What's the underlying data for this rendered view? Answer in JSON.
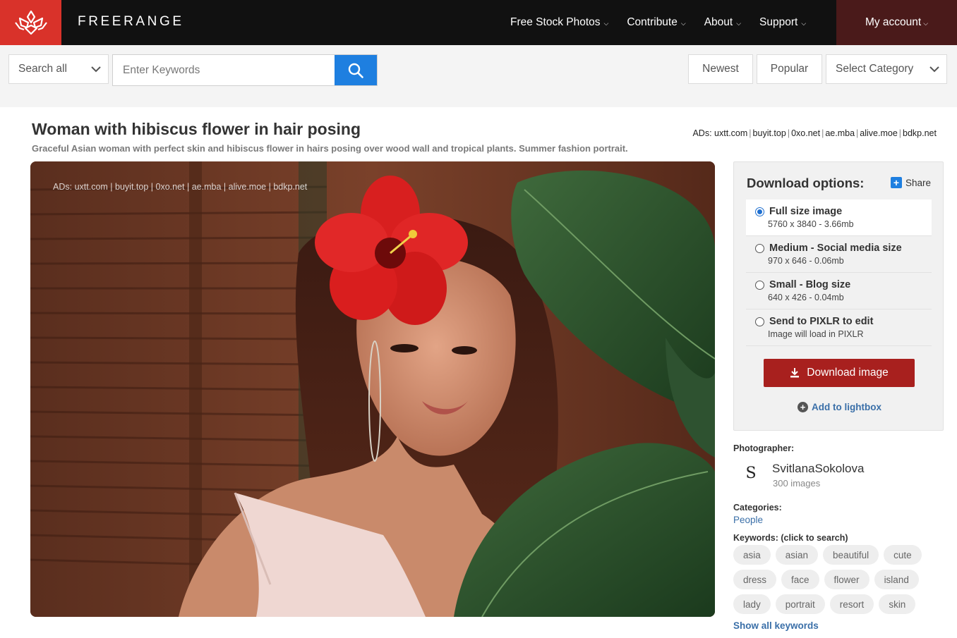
{
  "header": {
    "brand": "FREERANGE",
    "nav": [
      {
        "label": "Free Stock Photos"
      },
      {
        "label": "Contribute"
      },
      {
        "label": "About"
      },
      {
        "label": "Support"
      }
    ],
    "account_label": "My account",
    "logo_color": "#d9322a"
  },
  "search": {
    "scope_label": "Search all",
    "keyword_placeholder": "Enter Keywords",
    "newest_label": "Newest",
    "popular_label": "Popular",
    "category_label": "Select Category"
  },
  "photo": {
    "title": "Woman with hibiscus flower in hair posing",
    "description": "Graceful Asian woman with perfect skin and hibiscus flower in hairs posing over wood wall and tropical plants. Summer fashion portrait.",
    "ads_prefix": "ADs:",
    "ads": [
      "uxtt.com",
      "buyit.top",
      "0xo.net",
      "ae.mba",
      "alive.moe",
      "bdkp.net"
    ]
  },
  "download": {
    "title": "Download options:",
    "share_label": "Share",
    "options": [
      {
        "label": "Full size image",
        "meta": "5760 x 3840 - 3.66mb",
        "selected": true
      },
      {
        "label": "Medium - Social media size",
        "meta": "970 x 646 - 0.06mb",
        "selected": false
      },
      {
        "label": "Small - Blog size",
        "meta": "640 x 426 - 0.04mb",
        "selected": false
      },
      {
        "label": "Send to PIXLR to edit",
        "meta": "Image will load in PIXLR",
        "selected": false
      }
    ],
    "button_label": "Download image",
    "lightbox_label": "Add to lightbox",
    "button_color": "#a8201e"
  },
  "meta": {
    "photographer_label": "Photographer:",
    "photographer_initial": "S",
    "photographer_name": "SvitlanaSokolova",
    "photographer_count": "300 images",
    "categories_label": "Categories:",
    "category": "People",
    "keywords_label": "Keywords: (click to search)",
    "keywords": [
      [
        "asia",
        "asian",
        "beautiful",
        "cute"
      ],
      [
        "dress",
        "face",
        "flower",
        "island"
      ],
      [
        "lady",
        "portrait",
        "resort",
        "skin"
      ]
    ],
    "show_all_label": "Show all keywords"
  }
}
